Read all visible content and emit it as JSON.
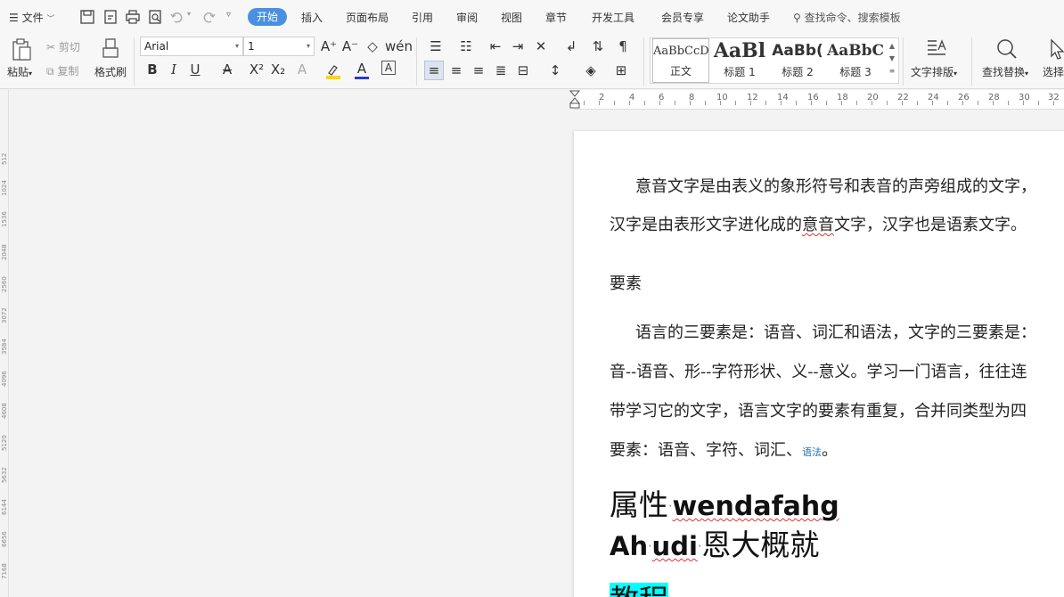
{
  "menubar": {
    "file": "文件",
    "tabs": [
      "开始",
      "插入",
      "页面布局",
      "引用",
      "审阅",
      "视图",
      "章节",
      "开发工具",
      "会员专享",
      "论文助手"
    ],
    "search_placeholder": "查找命令、搜索模板"
  },
  "ribbon": {
    "paste": "粘贴",
    "cut": "剪切",
    "copy": "复制",
    "format_painter": "格式刷",
    "font_name": "Arial",
    "font_size": "1",
    "styles": [
      {
        "sample": "AaBbCcD",
        "name": "正文"
      },
      {
        "sample": "AaBl",
        "name": "标题 1"
      },
      {
        "sample": "AaBb(",
        "name": "标题 2"
      },
      {
        "sample": "AaBbC",
        "name": "标题 3"
      }
    ],
    "text_layout": "文字排版",
    "find_replace": "查找替换",
    "select": "选择"
  },
  "ruler": {
    "top_numbers": [
      "2",
      "4",
      "6",
      "8",
      "10",
      "12",
      "14",
      "16",
      "18",
      "20",
      "22",
      "24",
      "26",
      "28",
      "30",
      "32"
    ],
    "left_numbers": [
      "512",
      "1024",
      "1536",
      "2048",
      "2560",
      "3072",
      "3584",
      "4096",
      "4608",
      "5120",
      "5632",
      "6144",
      "6656",
      "7168"
    ]
  },
  "document": {
    "p1_line1": "意音文字是由表义的象形符号和表音的声旁组成的文字，",
    "p1_line2_a": "汉字是由表形文字进化成的",
    "p1_line2_b": "意音",
    "p1_line2_c": "文字，汉字也是语素文字。",
    "heading_yaosu": "要素",
    "p2_line1": "语言的三要素是：语音、词汇和语法，文字的三要素是：",
    "p2_line2": "音--语音、形--字符形状、义--意义。学习一门语言，往往连",
    "p2_line3": "带学习它的文字，语言文字的要素有重复，合并同类型为四",
    "p2_line4_a": "要素：语音、字符、词汇、",
    "p2_line4_b": "语法",
    "p2_line4_c": "。",
    "h1_a": "属性",
    "h1_b": "wendafahg",
    "h2_a": "Ah",
    "h2_b": "udi",
    "h2_c": "恩大概就",
    "h3": "教程"
  }
}
